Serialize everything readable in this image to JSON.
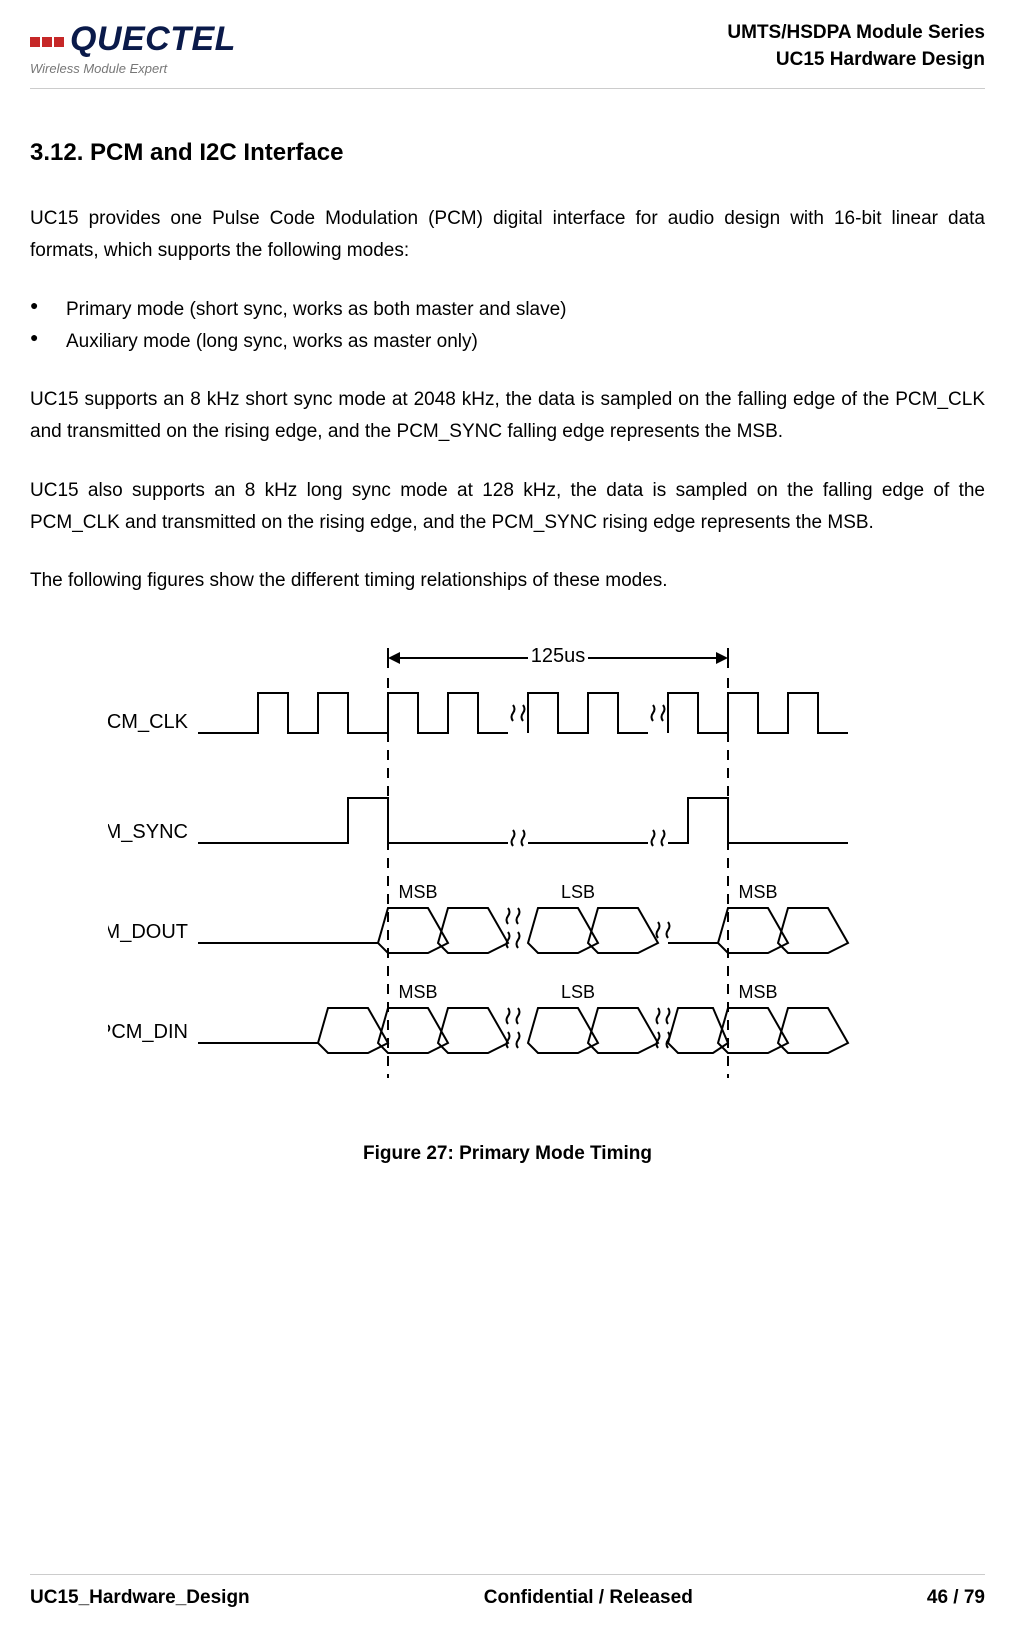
{
  "header": {
    "logo_name": "QUECTEL",
    "logo_tagline": "Wireless Module Expert",
    "line1": "UMTS/HSDPA Module Series",
    "line2": "UC15 Hardware Design"
  },
  "section": {
    "heading": "3.12. PCM and I2C Interface",
    "intro": "UC15 provides one Pulse Code Modulation (PCM) digital interface for audio design with 16-bit linear data formats, which supports the following modes:",
    "bullets": [
      "Primary mode (short sync, works as both master and slave)",
      "Auxiliary mode (long sync, works as master only)"
    ],
    "para2": "UC15 supports an 8 kHz short sync mode at 2048 kHz, the data is sampled on the falling edge of the PCM_CLK and transmitted on the rising edge, and the PCM_SYNC falling edge represents the MSB.",
    "para3": "UC15 also supports an 8 kHz long sync mode at 128 kHz, the data is sampled on the falling edge of the PCM_CLK and transmitted on the rising edge, and the PCM_SYNC rising edge represents the MSB.",
    "para4": "The following figures show the different timing relationships of these modes."
  },
  "diagram": {
    "period_label": "125us",
    "signals": {
      "clk": "PCM_CLK",
      "sync": "PCM_SYNC",
      "dout": "PCM_DOUT",
      "din": "PCM_DIN"
    },
    "data_labels": {
      "msb": "MSB",
      "lsb": "LSB"
    },
    "caption": "Figure 27: Primary Mode Timing"
  },
  "footer": {
    "left": "UC15_Hardware_Design",
    "center": "Confidential / Released",
    "right": "46 / 79"
  }
}
